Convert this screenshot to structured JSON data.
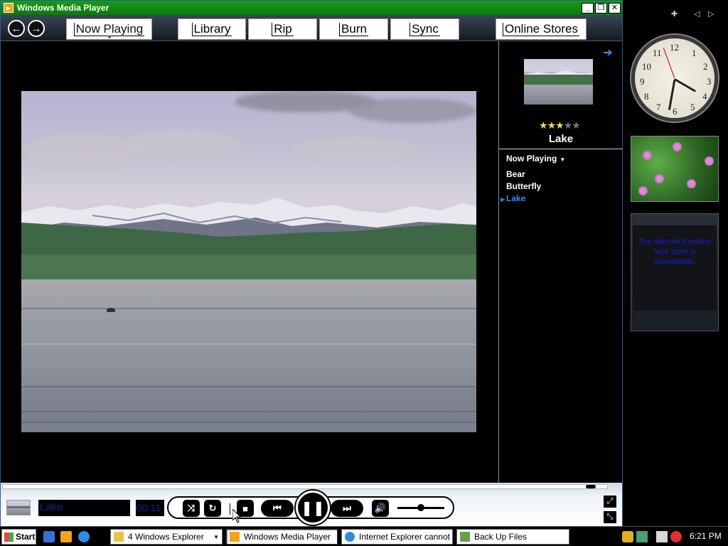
{
  "window": {
    "title": "Windows Media Player"
  },
  "nav": {
    "tabs": [
      {
        "label": "Now Playing",
        "active": true
      },
      {
        "label": "Library"
      },
      {
        "label": "Rip"
      },
      {
        "label": "Burn"
      },
      {
        "label": "Sync"
      },
      {
        "label": "Online Stores"
      }
    ]
  },
  "now_playing": {
    "title": "Lake",
    "rating": 3,
    "rating_max": 5,
    "playlist_header": "Now Playing",
    "playlist": [
      "Bear",
      "Butterfly",
      "Lake"
    ],
    "current_index": 2
  },
  "controls": {
    "track_name": "Lake",
    "elapsed": "00:11",
    "seek_fraction": 0.98,
    "volume_fraction": 0.5
  },
  "gadgets": {
    "clock_numbers": [
      "12",
      "1",
      "2",
      "3",
      "4",
      "5",
      "6",
      "7",
      "8",
      "9",
      "10",
      "11"
    ],
    "feed_message": "The Internet Explorer feed store is unavailable."
  },
  "taskbar": {
    "start_label": "Start",
    "tasks": [
      {
        "label": "4 Windows Explorer",
        "has_menu": true
      },
      {
        "label": "Windows Media Player",
        "active": true
      },
      {
        "label": "Internet Explorer cannot ..."
      },
      {
        "label": "Back Up Files"
      }
    ],
    "time": "6:21 PM"
  },
  "colors": {
    "titlebar": "#0c7a0c",
    "playlist_current": "#3a86e8",
    "stars_on": "#f3d56b",
    "feed_text": "#1a1ad8"
  }
}
